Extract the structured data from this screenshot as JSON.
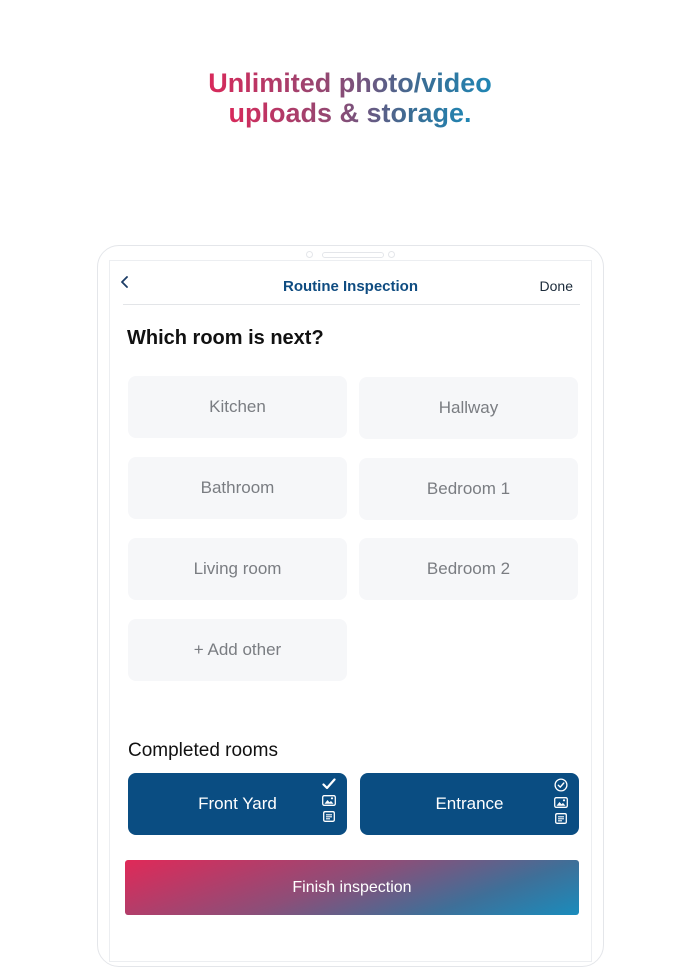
{
  "headline": {
    "line1": "Unlimited photo/video",
    "line2": "uploads & storage."
  },
  "navbar": {
    "back_icon": "chevron-left-icon",
    "title": "Routine Inspection",
    "done_label": "Done"
  },
  "question": "Which room is next?",
  "rooms": [
    {
      "label": "Kitchen"
    },
    {
      "label": "Hallway"
    },
    {
      "label": "Bathroom"
    },
    {
      "label": "Bedroom 1"
    },
    {
      "label": "Living room"
    },
    {
      "label": "Bedroom 2"
    },
    {
      "label": "+ Add other"
    }
  ],
  "completed": {
    "title": "Completed rooms",
    "items": [
      {
        "label": "Front Yard",
        "status_icon": "check-icon"
      },
      {
        "label": "Entrance",
        "status_icon": "check-circle-icon"
      }
    ]
  },
  "finish_label": "Finish inspection",
  "colors": {
    "primary": "#0a4d82",
    "gradient_start": "#e02958",
    "gradient_end": "#1a8cbc",
    "tile_bg": "#f6f7f9"
  }
}
